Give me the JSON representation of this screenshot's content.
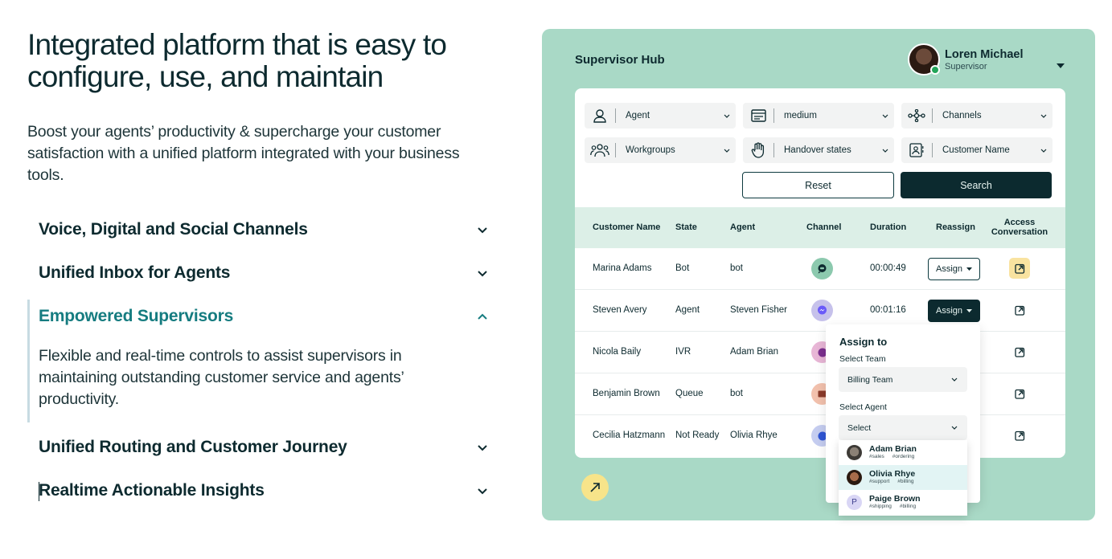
{
  "hero": {
    "headline_line1": "Integrated platform that is easy to",
    "headline_line2": "configure, use, and maintain",
    "subcopy": "Boost your agents’ productivity & supercharge your customer satisfaction with a unified platform integrated with your business tools."
  },
  "accordion": {
    "items": [
      {
        "label": "Voice, Digital and Social Channels",
        "icon": "chevron-down-icon"
      },
      {
        "label": "Unified Inbox for Agents",
        "icon": "chevron-down-icon"
      },
      {
        "label": "Empowered Supervisors",
        "icon": "chevron-up-icon"
      },
      {
        "label": "Unified Routing and Customer Journey",
        "icon": "chevron-down-icon"
      },
      {
        "label": "Realtime Actionable Insights",
        "icon": "chevron-down-icon"
      }
    ],
    "active_description": "Flexible and real-time controls to assist supervisors in maintaining outstanding customer service and agents’ productivity."
  },
  "hub": {
    "title": "Supervisor Hub",
    "user": {
      "name": "Loren Michael",
      "role": "Supervisor"
    },
    "filters": [
      {
        "label": "Agent",
        "icon": "user-icon"
      },
      {
        "label": "medium",
        "icon": "inbox-icon"
      },
      {
        "label": "Channels",
        "icon": "network-icon"
      },
      {
        "label": "Workgroups",
        "icon": "group-icon"
      },
      {
        "label": "Handover states",
        "icon": "hand-icon"
      },
      {
        "label": "Customer Name",
        "icon": "contact-card-icon"
      }
    ],
    "reset_label": "Reset",
    "search_label": "Search",
    "columns": [
      "Customer Name",
      "State",
      "Agent",
      "Channel",
      "Duration",
      "Reassign",
      "Access Conversation"
    ],
    "rows": [
      {
        "customer": "Marina Adams",
        "state": "Bot",
        "agent": "bot",
        "channel": "chat",
        "duration": "00:00:49",
        "reassign": "Assign"
      },
      {
        "customer": "Steven Avery",
        "state": "Agent",
        "agent": "Steven Fisher",
        "channel": "messenger",
        "duration": "00:01:16",
        "reassign": "Assign"
      },
      {
        "customer": "Nicola Baily",
        "state": "IVR",
        "agent": "Adam Brian",
        "channel": "viber",
        "duration": "",
        "reassign": ""
      },
      {
        "customer": "Benjamin Brown",
        "state": "Queue",
        "agent": "bot",
        "channel": "email",
        "duration": "",
        "reassign": ""
      },
      {
        "customer": "Cecilia Hatzmann",
        "state": "Not Ready",
        "agent": "Olivia Rhye",
        "channel": "facebook",
        "duration": "",
        "reassign": ""
      }
    ],
    "popup": {
      "title": "Assign to",
      "team_label": "Select Team",
      "team_value": "Billing Team",
      "agent_label": "Select Agent",
      "agent_value": "Select",
      "agents": [
        {
          "name": "Adam Brian",
          "tags": [
            "#sales",
            "#ordering"
          ]
        },
        {
          "name": "Olivia Rhye",
          "tags": [
            "#support",
            "#billing"
          ]
        },
        {
          "name": "Paige Brown",
          "initial": "P",
          "tags": [
            "#shipping",
            "#billing"
          ]
        }
      ]
    }
  },
  "colors": {
    "panel_bg": "#a9d9c6",
    "dark": "#0c2a2f",
    "accent": "#167c80",
    "header_bg": "#dcefe7",
    "highlight": "#f9e3a0"
  }
}
